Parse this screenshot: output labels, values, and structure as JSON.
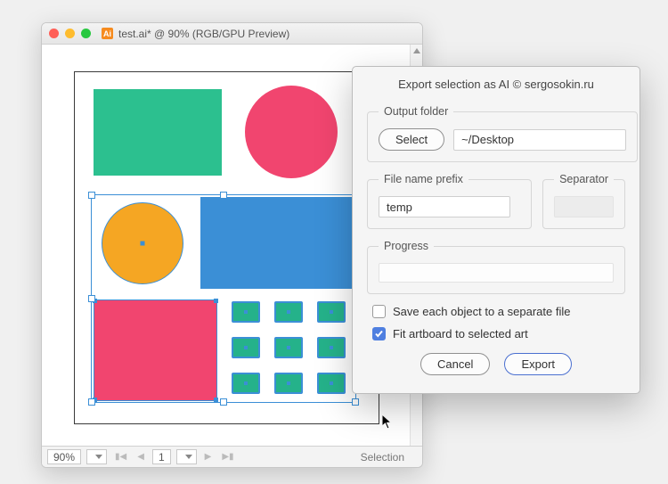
{
  "window": {
    "title": "test.ai* @ 90% (RGB/GPU Preview)",
    "doc_icon_label": "Ai"
  },
  "statusbar": {
    "zoom": "90%",
    "page": "1",
    "tool": "Selection"
  },
  "dialog": {
    "title": "Export selection as AI  © sergosokin.ru",
    "output_folder": {
      "legend": "Output folder",
      "select_label": "Select",
      "path": "~/Desktop"
    },
    "file_prefix": {
      "legend": "File name prefix",
      "value": "temp"
    },
    "separator": {
      "legend": "Separator"
    },
    "progress": {
      "legend": "Progress"
    },
    "checkboxes": {
      "save_each": {
        "label": "Save each object to a separate file",
        "checked": false
      },
      "fit_artboard": {
        "label": "Fit artboard to selected art",
        "checked": true
      }
    },
    "buttons": {
      "cancel": "Cancel",
      "export": "Export"
    }
  },
  "art": {
    "colors": {
      "teal": "#2cc08f",
      "pink": "#f1456f",
      "blue": "#3b8fd6",
      "orange": "#f5a623"
    }
  }
}
